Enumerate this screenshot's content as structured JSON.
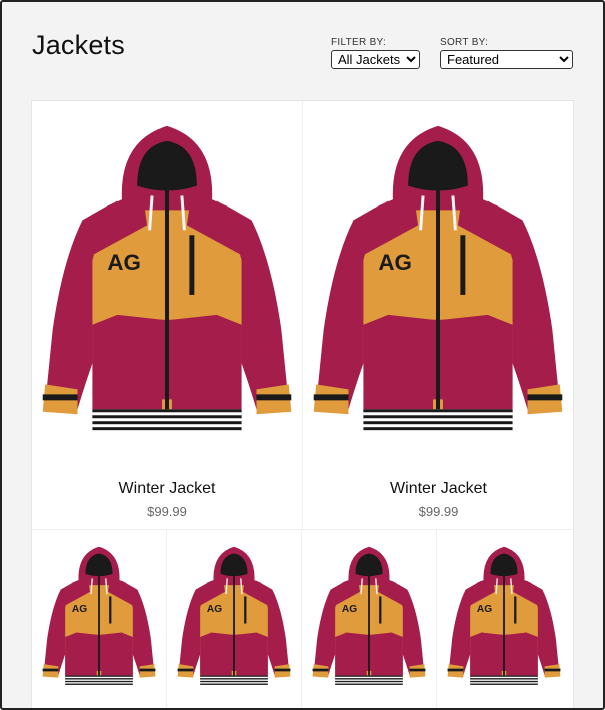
{
  "page": {
    "title": "Jackets"
  },
  "filter": {
    "label": "FILTER BY:",
    "selected": "All Jackets"
  },
  "sort": {
    "label": "SORT BY:",
    "selected": "Featured"
  },
  "products": [
    {
      "name": "Winter Jacket",
      "price": "$99.99",
      "logo": "AG"
    },
    {
      "name": "Winter Jacket",
      "price": "$99.99",
      "logo": "AG"
    },
    {
      "name": "",
      "price": "",
      "logo": "AG"
    },
    {
      "name": "",
      "price": "",
      "logo": "AG"
    },
    {
      "name": "",
      "price": "",
      "logo": "AG"
    },
    {
      "name": "",
      "price": "",
      "logo": "AG"
    }
  ],
  "colors": {
    "jacket_red": "#a51d4a",
    "jacket_orange": "#df9b3c",
    "trim_dark": "#1a1a1a",
    "page_bg": "#f3f3f3"
  }
}
